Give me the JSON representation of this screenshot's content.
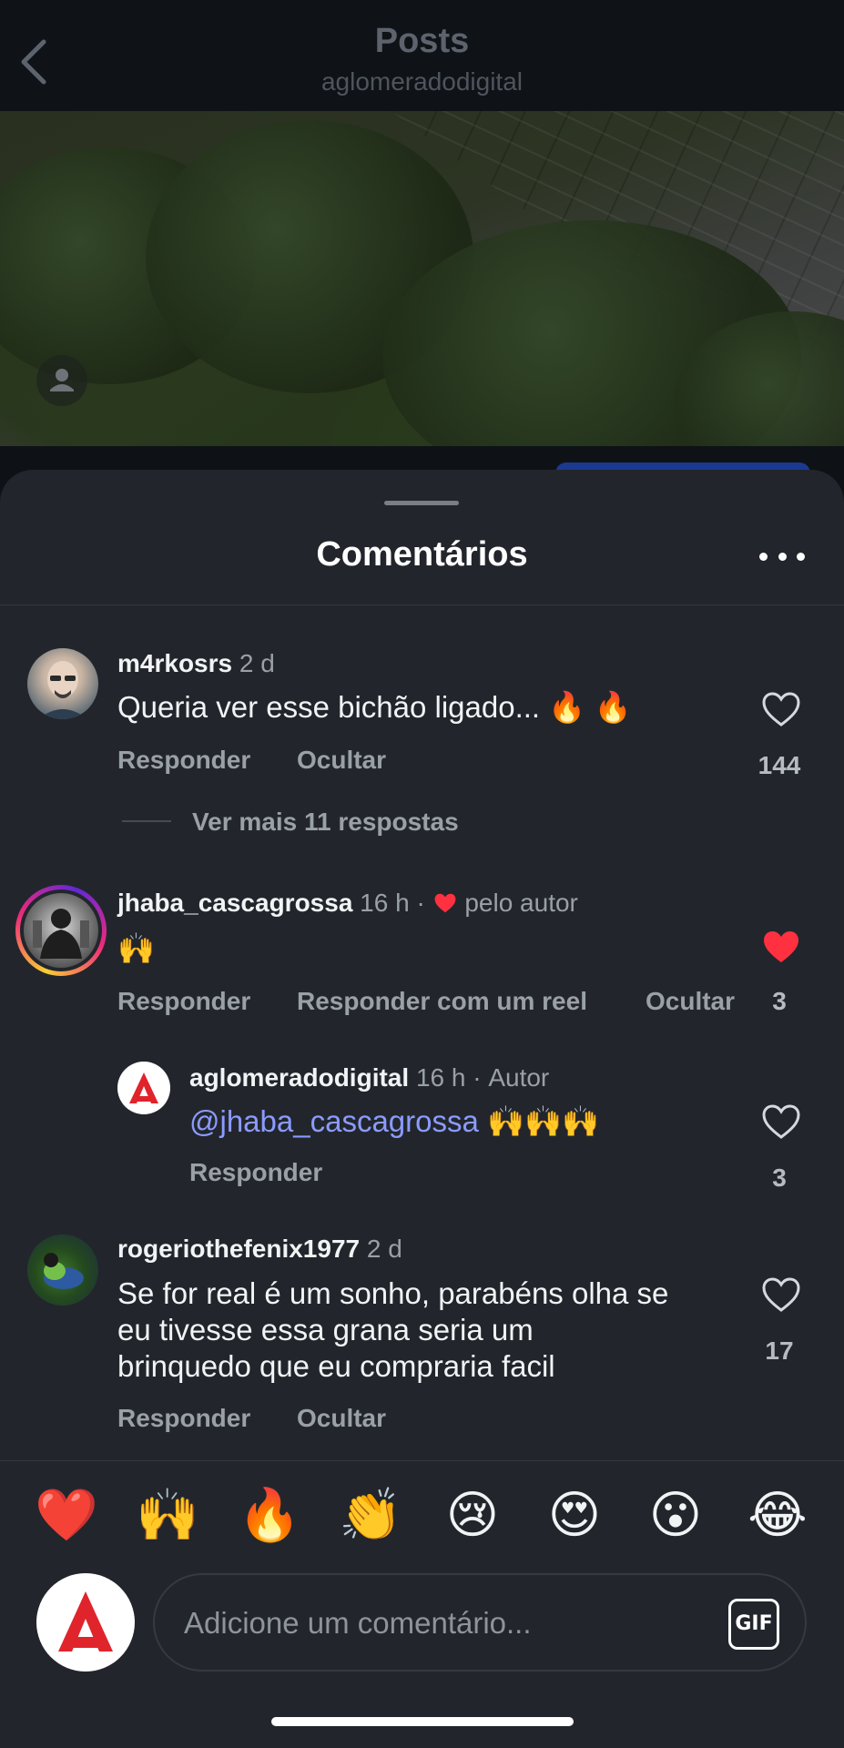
{
  "header": {
    "title": "Posts",
    "subtitle": "aglomeradodigital",
    "back_icon": "chevron-left-icon"
  },
  "sheet": {
    "title": "Comentários",
    "more_icon": "more-horizontal-icon"
  },
  "comments": [
    {
      "username": "m4rkosrs",
      "time": "2 d",
      "text": "Queria ver esse bichão ligado... 🔥 🔥",
      "actions": [
        "Responder",
        "Ocultar"
      ],
      "likes": "144",
      "liked": false,
      "view_replies": "Ver mais 11 respostas"
    },
    {
      "username": "jhaba_cascagrossa",
      "time": "16 h",
      "separator": "·",
      "liked_by_author": "pelo autor",
      "text": "🙌",
      "actions": [
        "Responder",
        "Responder com um reel",
        "Ocultar"
      ],
      "likes": "3",
      "liked": true
    },
    {
      "username": "aglomeradodigital",
      "time": "16 h",
      "separator": "·",
      "role": "Autor",
      "mention": "@jhaba_cascagrossa",
      "text": "🙌🙌🙌",
      "actions": [
        "Responder"
      ],
      "likes": "3",
      "liked": false
    },
    {
      "username": "rogeriothefenix1977",
      "time": "2 d",
      "text_lines": [
        "Se for real é um sonho, parabéns olha se",
        "eu tivesse essa grana seria um",
        "brinquedo que eu compraria facil"
      ],
      "actions": [
        "Responder",
        "Ocultar"
      ],
      "likes": "17",
      "liked": false
    }
  ],
  "emoji_bar": [
    "❤️",
    "🙌",
    "🔥",
    "👏",
    "😢",
    "😍",
    "😮",
    "😂"
  ],
  "composer": {
    "placeholder": "Adicione um comentário...",
    "gif_label": "GIF"
  },
  "colors": {
    "sheet_bg": "#22262c",
    "like_red": "#ff3040",
    "mention_blue": "#8b9bff",
    "brand_red": "#e0242b"
  }
}
